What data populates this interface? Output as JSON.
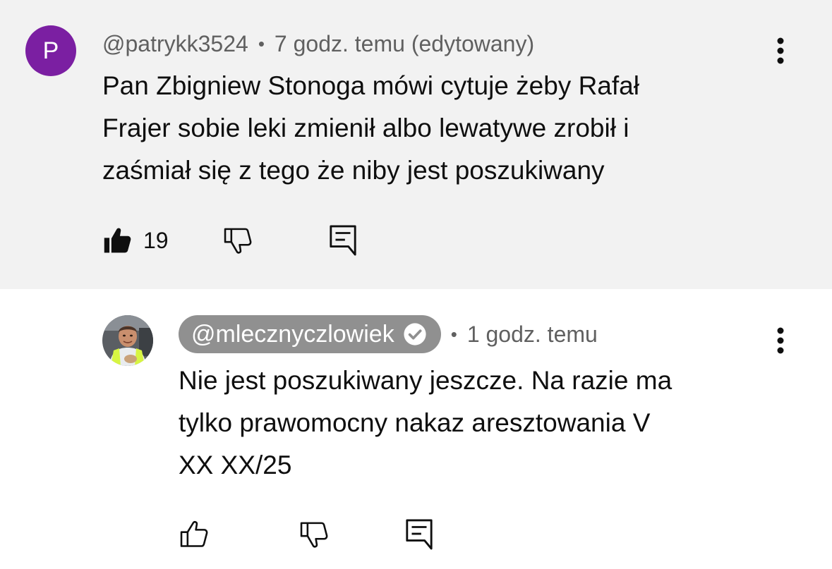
{
  "thread": {
    "parent": {
      "avatar_letter": "P",
      "avatar_color": "#7b1fa2",
      "author": "@patrykk3524",
      "separator": "•",
      "time": "7 godz. temu (edytowany)",
      "text": "Pan Zbigniew Stonoga mówi cytuje  żeby Rafał\nFrajer sobie leki zmienił albo lewatywe zrobił i\nzaśmiał się z tego że niby jest poszukiwany",
      "like_count": "19",
      "liked": true,
      "icons": {
        "like": "thumbs-up-filled-icon",
        "dislike": "thumbs-down-outline-icon",
        "reply": "comment-reply-icon",
        "more": "more-vertical-icon"
      }
    },
    "reply": {
      "author": "@mlecznyczlowiek",
      "author_badge": "verified-icon",
      "author_highlighted": true,
      "separator": "•",
      "time": "1 godz. temu",
      "text": "Nie jest poszukiwany jeszcze. Na razie ma\ntylko prawomocny nakaz aresztowania V\nXX XX/25",
      "icons": {
        "like": "thumbs-up-outline-icon",
        "dislike": "thumbs-down-outline-icon",
        "reply": "comment-reply-icon",
        "more": "more-vertical-icon"
      }
    }
  },
  "colors": {
    "parent_background": "#f2f2f2",
    "reply_background": "#ffffff",
    "secondary_text": "#606060",
    "primary_text": "#0f0f0f",
    "creator_pill": "#909090"
  }
}
